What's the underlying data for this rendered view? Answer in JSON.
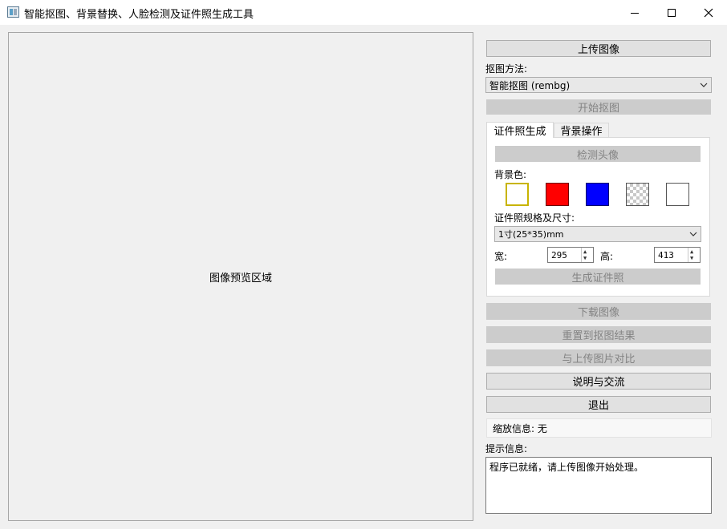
{
  "window": {
    "title": "智能抠图、背景替换、人脸检测及证件照生成工具",
    "minimize_glyph": "—",
    "maximize_glyph": "☐",
    "close_glyph": "✕"
  },
  "preview": {
    "label": "图像预览区域"
  },
  "controls": {
    "upload_label": "上传图像",
    "matting_method_label": "抠图方法:",
    "matting_method_value": "智能抠图 (rembg)",
    "start_matting_label": "开始抠图"
  },
  "tabs": [
    {
      "label": "证件照生成",
      "active": true
    },
    {
      "label": "背景操作",
      "active": false
    }
  ],
  "id_photo": {
    "detect_face_label": "检测头像",
    "bg_color_label": "背景色:",
    "swatches": [
      {
        "name": "white",
        "color": "#ffffff",
        "selected": true
      },
      {
        "name": "red",
        "color": "#ff0000",
        "selected": false
      },
      {
        "name": "blue",
        "color": "#0000ff",
        "selected": false
      },
      {
        "name": "transparent",
        "color": "transparent",
        "selected": false
      },
      {
        "name": "custom",
        "color": "#ffffff",
        "selected": false
      }
    ],
    "spec_label": "证件照规格及尺寸:",
    "spec_value": "1寸(25*35)mm",
    "width_label": "宽:",
    "width_value": "295",
    "height_label": "高:",
    "height_value": "413",
    "generate_label": "生成证件照"
  },
  "actions": {
    "download_label": "下载图像",
    "reset_label": "重置到抠图结果",
    "compare_label": "与上传图片对比",
    "help_label": "说明与交流",
    "exit_label": "退出"
  },
  "zoom_info": "缩放信息: 无",
  "hint": {
    "label": "提示信息:",
    "message": "程序已就绪，请上传图像开始处理。"
  },
  "colors": {
    "selected_swatch_border": "#c8b400",
    "disabled_button": "#cccccc",
    "button": "#e1e1e1"
  }
}
